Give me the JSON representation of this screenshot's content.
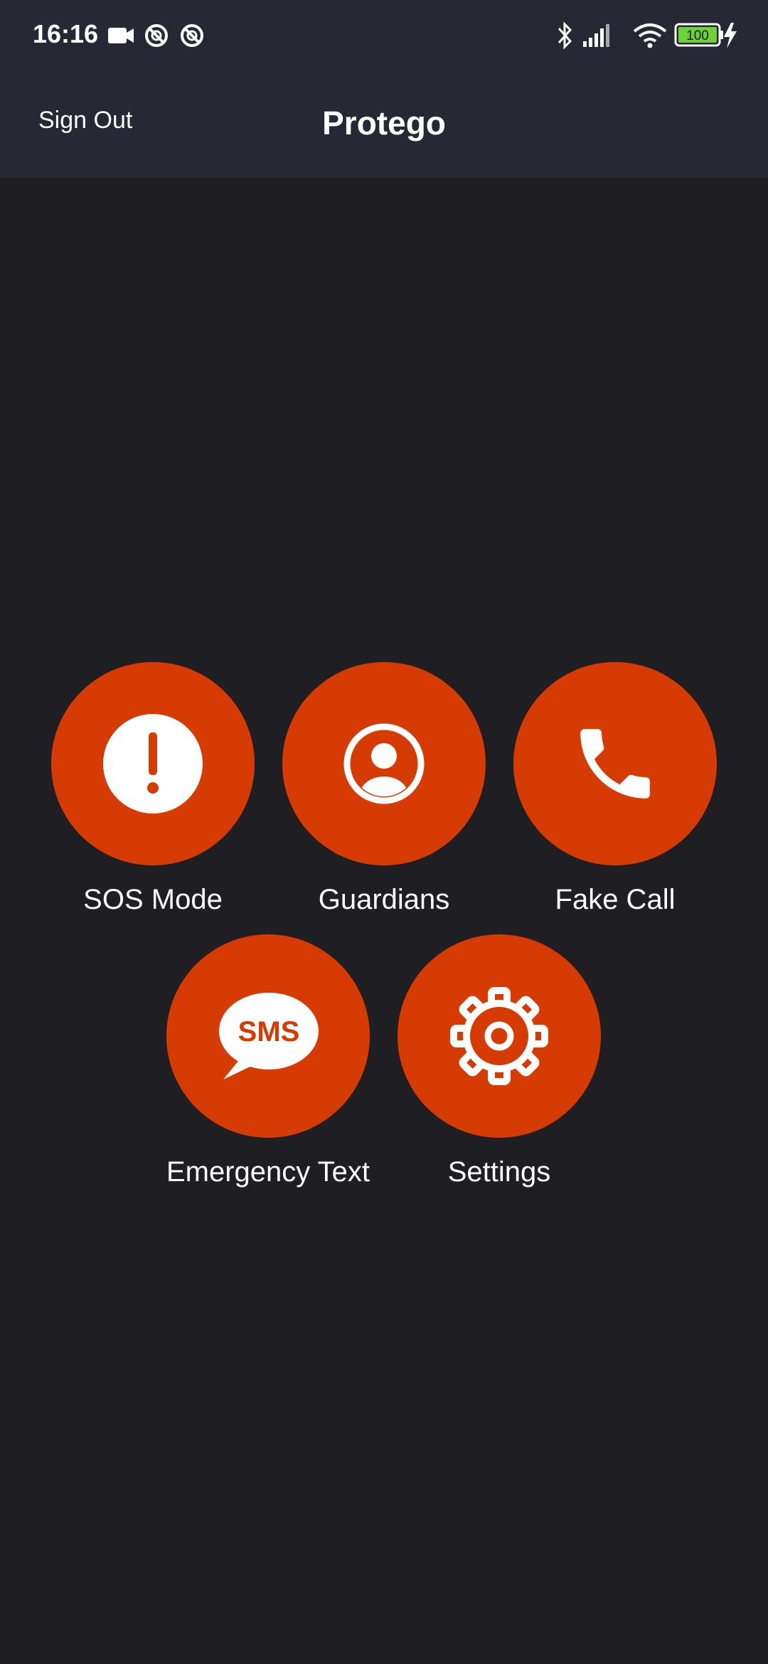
{
  "status_bar": {
    "time": "16:16",
    "left_icons": [
      "video-camera-icon",
      "notification-off-icon",
      "notification-off-icon"
    ],
    "right_icons": [
      "bluetooth-icon",
      "signal-icon",
      "wifi-icon",
      "battery-icon",
      "charging-icon"
    ],
    "battery_level": "100"
  },
  "app_bar": {
    "sign_out_label": "Sign Out",
    "title": "Protego"
  },
  "actions": [
    {
      "label": "SOS Mode",
      "icon": "exclamation-icon"
    },
    {
      "label": "Guardians",
      "icon": "user-circle-icon"
    },
    {
      "label": "Fake Call",
      "icon": "phone-icon"
    },
    {
      "label": "Emergency Text",
      "icon": "sms-bubble-icon",
      "icon_text": "SMS"
    },
    {
      "label": "Settings",
      "icon": "gear-icon"
    }
  ],
  "colors": {
    "accent": "#d73b04",
    "background": "#1f1e23",
    "bar_background": "#272834",
    "battery_fill": "#6dd13b"
  }
}
